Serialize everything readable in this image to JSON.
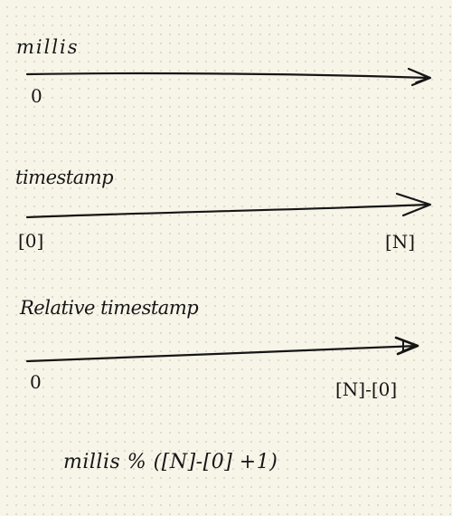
{
  "timelines": [
    {
      "label": "millis",
      "start": "0",
      "end": ""
    },
    {
      "label": "timestamp",
      "start": "[0]",
      "end": "[N]"
    },
    {
      "label": "Relative timestamp",
      "start": "0",
      "end": "[N]-[0]"
    }
  ],
  "formula": "millis % ([N]-[0] +1)",
  "colors": {
    "ink": "#161616",
    "paper": "#f7f4e8",
    "dots": "#d9d5c4"
  }
}
